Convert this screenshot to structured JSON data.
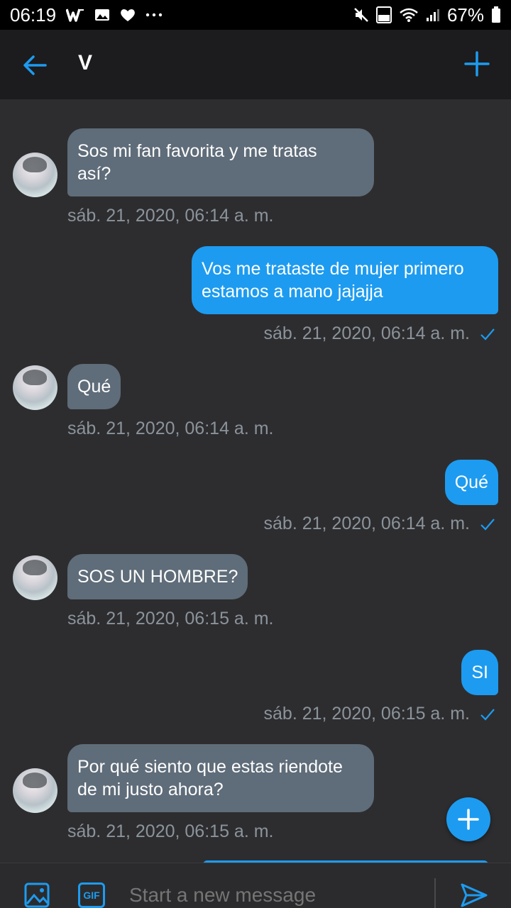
{
  "status_bar": {
    "time": "06:19",
    "battery": "67%",
    "icons": [
      "w-app-icon",
      "gallery-icon",
      "heart-icon",
      "more-dots-icon",
      "mute-icon",
      "volte-4g-icon",
      "wifi-icon",
      "signal-icon",
      "battery-icon"
    ]
  },
  "header": {
    "title": "V",
    "back_icon": "arrow-left-icon",
    "add_icon": "plus-icon"
  },
  "messages": [
    {
      "direction": "in",
      "text": "Sos mi fan favorita y me tratas\nasí?",
      "timestamp": "sáb. 21, 2020, 06:14 a. m."
    },
    {
      "direction": "out",
      "text": "Vos me trataste de mujer primero\nestamos a mano jajajja",
      "timestamp": "sáb. 21, 2020, 06:14 a. m.",
      "status": "sent"
    },
    {
      "direction": "in",
      "text": "Qué",
      "timestamp": "sáb. 21, 2020, 06:14 a. m."
    },
    {
      "direction": "out",
      "text": "Qué",
      "timestamp": "sáb. 21, 2020, 06:14 a. m.",
      "status": "sent"
    },
    {
      "direction": "in",
      "text": "SOS UN HOMBRE?",
      "timestamp": "sáb. 21, 2020, 06:15 a. m."
    },
    {
      "direction": "out",
      "text": "SI",
      "timestamp": "sáb. 21, 2020, 06:15 a. m.",
      "status": "sent"
    },
    {
      "direction": "in",
      "text": "Por qué siento que estas riendote\nde mi justo ahora?",
      "timestamp": "sáb. 21, 2020, 06:15 a. m."
    }
  ],
  "composer": {
    "placeholder": "Start a new message",
    "gif_label": "GIF",
    "image_icon": "image-icon",
    "send_icon": "send-icon"
  },
  "colors": {
    "accent": "#1d9bf0",
    "incoming_bubble": "#5f6c79",
    "background": "#2d2d2f",
    "header": "#1c1c1e",
    "timestamp": "#8b939b"
  }
}
